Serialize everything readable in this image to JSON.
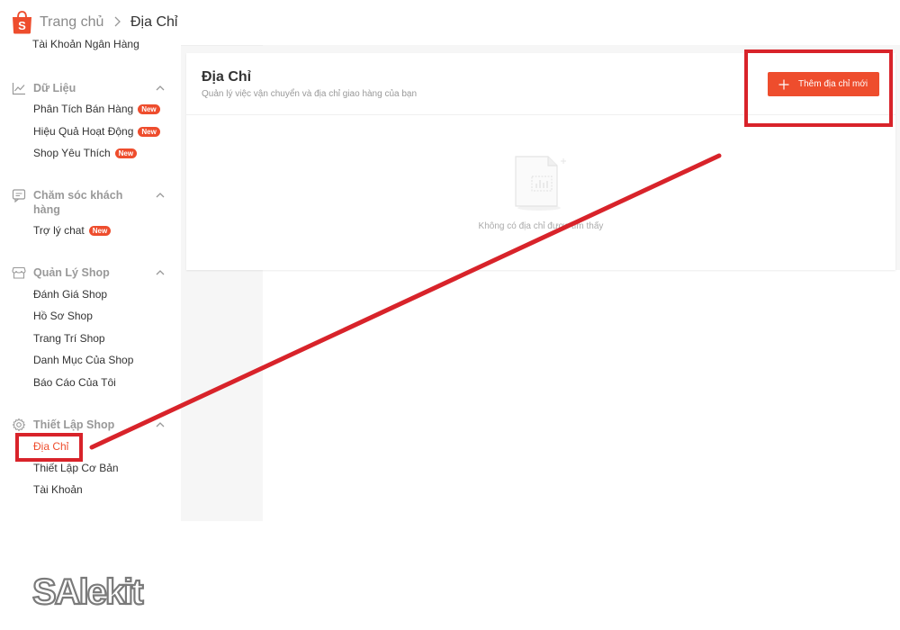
{
  "header": {
    "breadcrumb_home": "Trang chủ",
    "breadcrumb_current": "Địa Chỉ"
  },
  "sidebar": {
    "cut_item": "Tài Khoản Ngân Hàng",
    "sections": [
      {
        "title": "Dữ Liệu",
        "icon": "chart-line-icon",
        "items": [
          {
            "label": "Phân Tích Bán Hàng",
            "badge": "New"
          },
          {
            "label": "Hiệu Quả Hoạt Động",
            "badge": "New"
          },
          {
            "label": "Shop Yêu Thích",
            "badge": "New"
          }
        ]
      },
      {
        "title": "Chăm sóc khách hàng",
        "icon": "chat-bubble-icon",
        "items": [
          {
            "label": "Trợ lý chat",
            "badge": "New"
          }
        ]
      },
      {
        "title": "Quản Lý Shop",
        "icon": "store-icon",
        "items": [
          {
            "label": "Đánh Giá Shop"
          },
          {
            "label": "Hồ Sơ Shop"
          },
          {
            "label": "Trang Trí Shop"
          },
          {
            "label": "Danh Mục Của Shop"
          },
          {
            "label": "Báo Cáo Của Tôi"
          }
        ]
      },
      {
        "title": "Thiết Lập Shop",
        "icon": "gear-icon",
        "items": [
          {
            "label": "Địa Chỉ",
            "active": true
          },
          {
            "label": "Thiết Lập Cơ Bản"
          },
          {
            "label": "Tài Khoản"
          }
        ]
      }
    ]
  },
  "main": {
    "title": "Địa Chỉ",
    "subtitle": "Quản lý việc vận chuyển và địa chỉ giao hàng của bạn",
    "add_button": "Thêm địa chỉ mới",
    "empty_text": "Không có địa chỉ được tìm thấy"
  },
  "watermark": "SAlekit",
  "colors": {
    "accent": "#ee4d2d",
    "annotation": "#d8232a"
  }
}
